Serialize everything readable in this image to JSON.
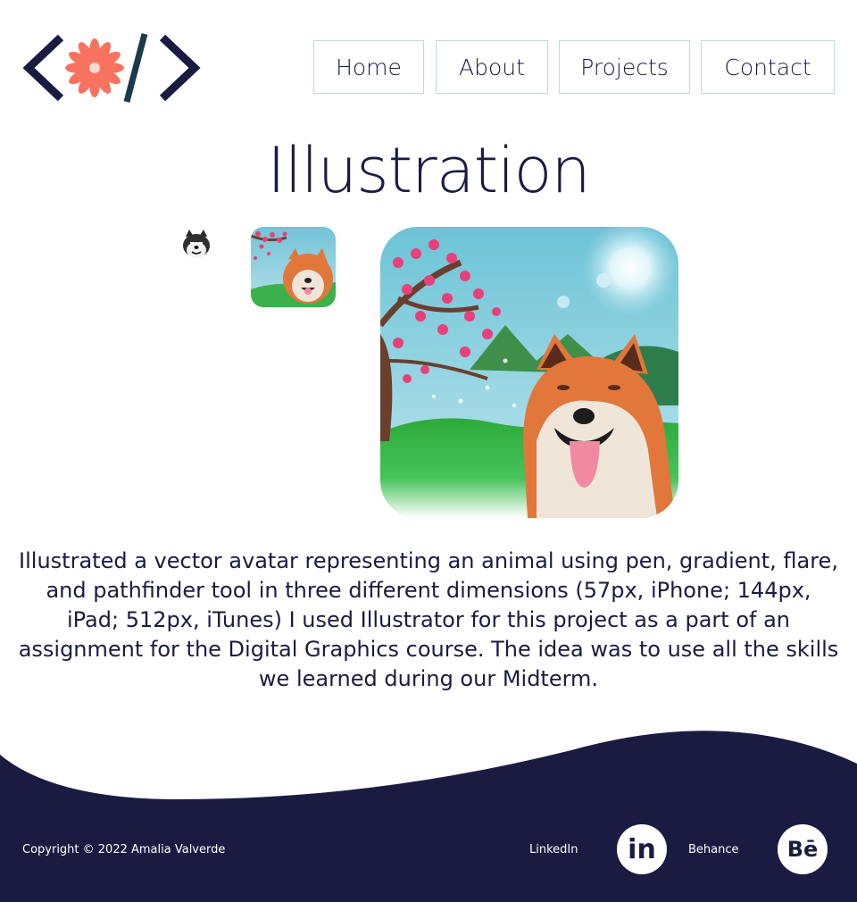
{
  "brand": {
    "logo_icon": "code-flower-logo",
    "accent": "#f8735f",
    "navy": "#1b1b42"
  },
  "nav": {
    "items": [
      {
        "label": "Home"
      },
      {
        "label": "About"
      },
      {
        "label": "Projects"
      },
      {
        "label": "Contact"
      }
    ]
  },
  "page": {
    "title": "Illustration",
    "description": "Illustrated a vector avatar representing an animal using pen, gradient, flare, and pathfinder tool in three different dimensions (57px, iPhone; 144px, iPad; 512px, iTunes) I used Illustrator for this project as a part of an assignment for the Digital Graphics course. The idea was to use all the skills we learned during our Midterm."
  },
  "images": [
    {
      "icon": "shiba-avatar-57px"
    },
    {
      "icon": "shiba-avatar-144px"
    },
    {
      "icon": "shiba-avatar-512px"
    }
  ],
  "footer": {
    "copyright": "Copyright © 2022 Amalia Valverde",
    "linkedin_label": "LinkedIn",
    "linkedin_glyph": "in",
    "behance_label": "Behance",
    "behance_glyph": "Bē"
  }
}
